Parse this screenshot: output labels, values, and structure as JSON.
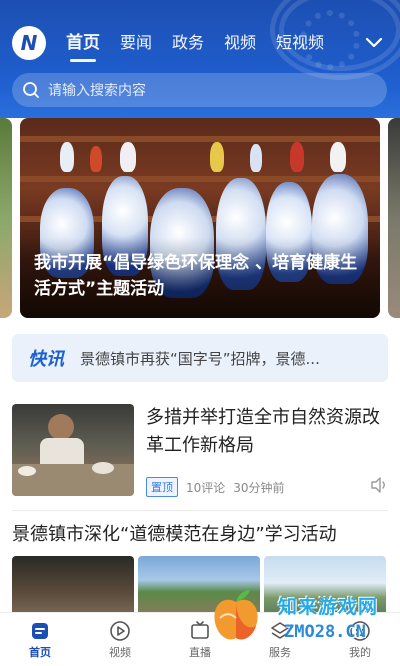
{
  "header": {
    "logo_letter": "N",
    "tabs": [
      {
        "label": "首页",
        "active": true
      },
      {
        "label": "要闻",
        "active": false
      },
      {
        "label": "政务",
        "active": false
      },
      {
        "label": "视频",
        "active": false
      },
      {
        "label": "短视频",
        "active": false
      }
    ],
    "more_icon": "chevron-down-icon",
    "search_placeholder": "请输入搜索内容"
  },
  "banner": {
    "caption": "我市开展“倡导绿色环保理念 、培育健康生活方式”主题活动"
  },
  "flash": {
    "tag": "快讯",
    "text": "景德镇市再获“国字号”招牌，景德..."
  },
  "article": {
    "title": "多措并举打造全市自然资源改革工作新格局",
    "badge": "置顶",
    "comments": "10评论",
    "time": "30分钟前"
  },
  "section": {
    "title": "景德镇市深化“道德模范在身边”学习活动"
  },
  "bottom_nav": [
    {
      "label": "首页",
      "icon": "home-icon",
      "active": true
    },
    {
      "label": "视频",
      "icon": "play-icon",
      "active": false
    },
    {
      "label": "直播",
      "icon": "live-icon",
      "active": false
    },
    {
      "label": "服务",
      "icon": "service-icon",
      "active": false
    },
    {
      "label": "我的",
      "icon": "profile-icon",
      "active": false
    }
  ],
  "watermark": {
    "line1": "知来游戏网",
    "line2": "ZMO28.CN"
  },
  "colors": {
    "brand_blue": "#1d4fb2",
    "accent_blue": "#1d5fd0",
    "flash_bg": "#eaf1fb"
  }
}
